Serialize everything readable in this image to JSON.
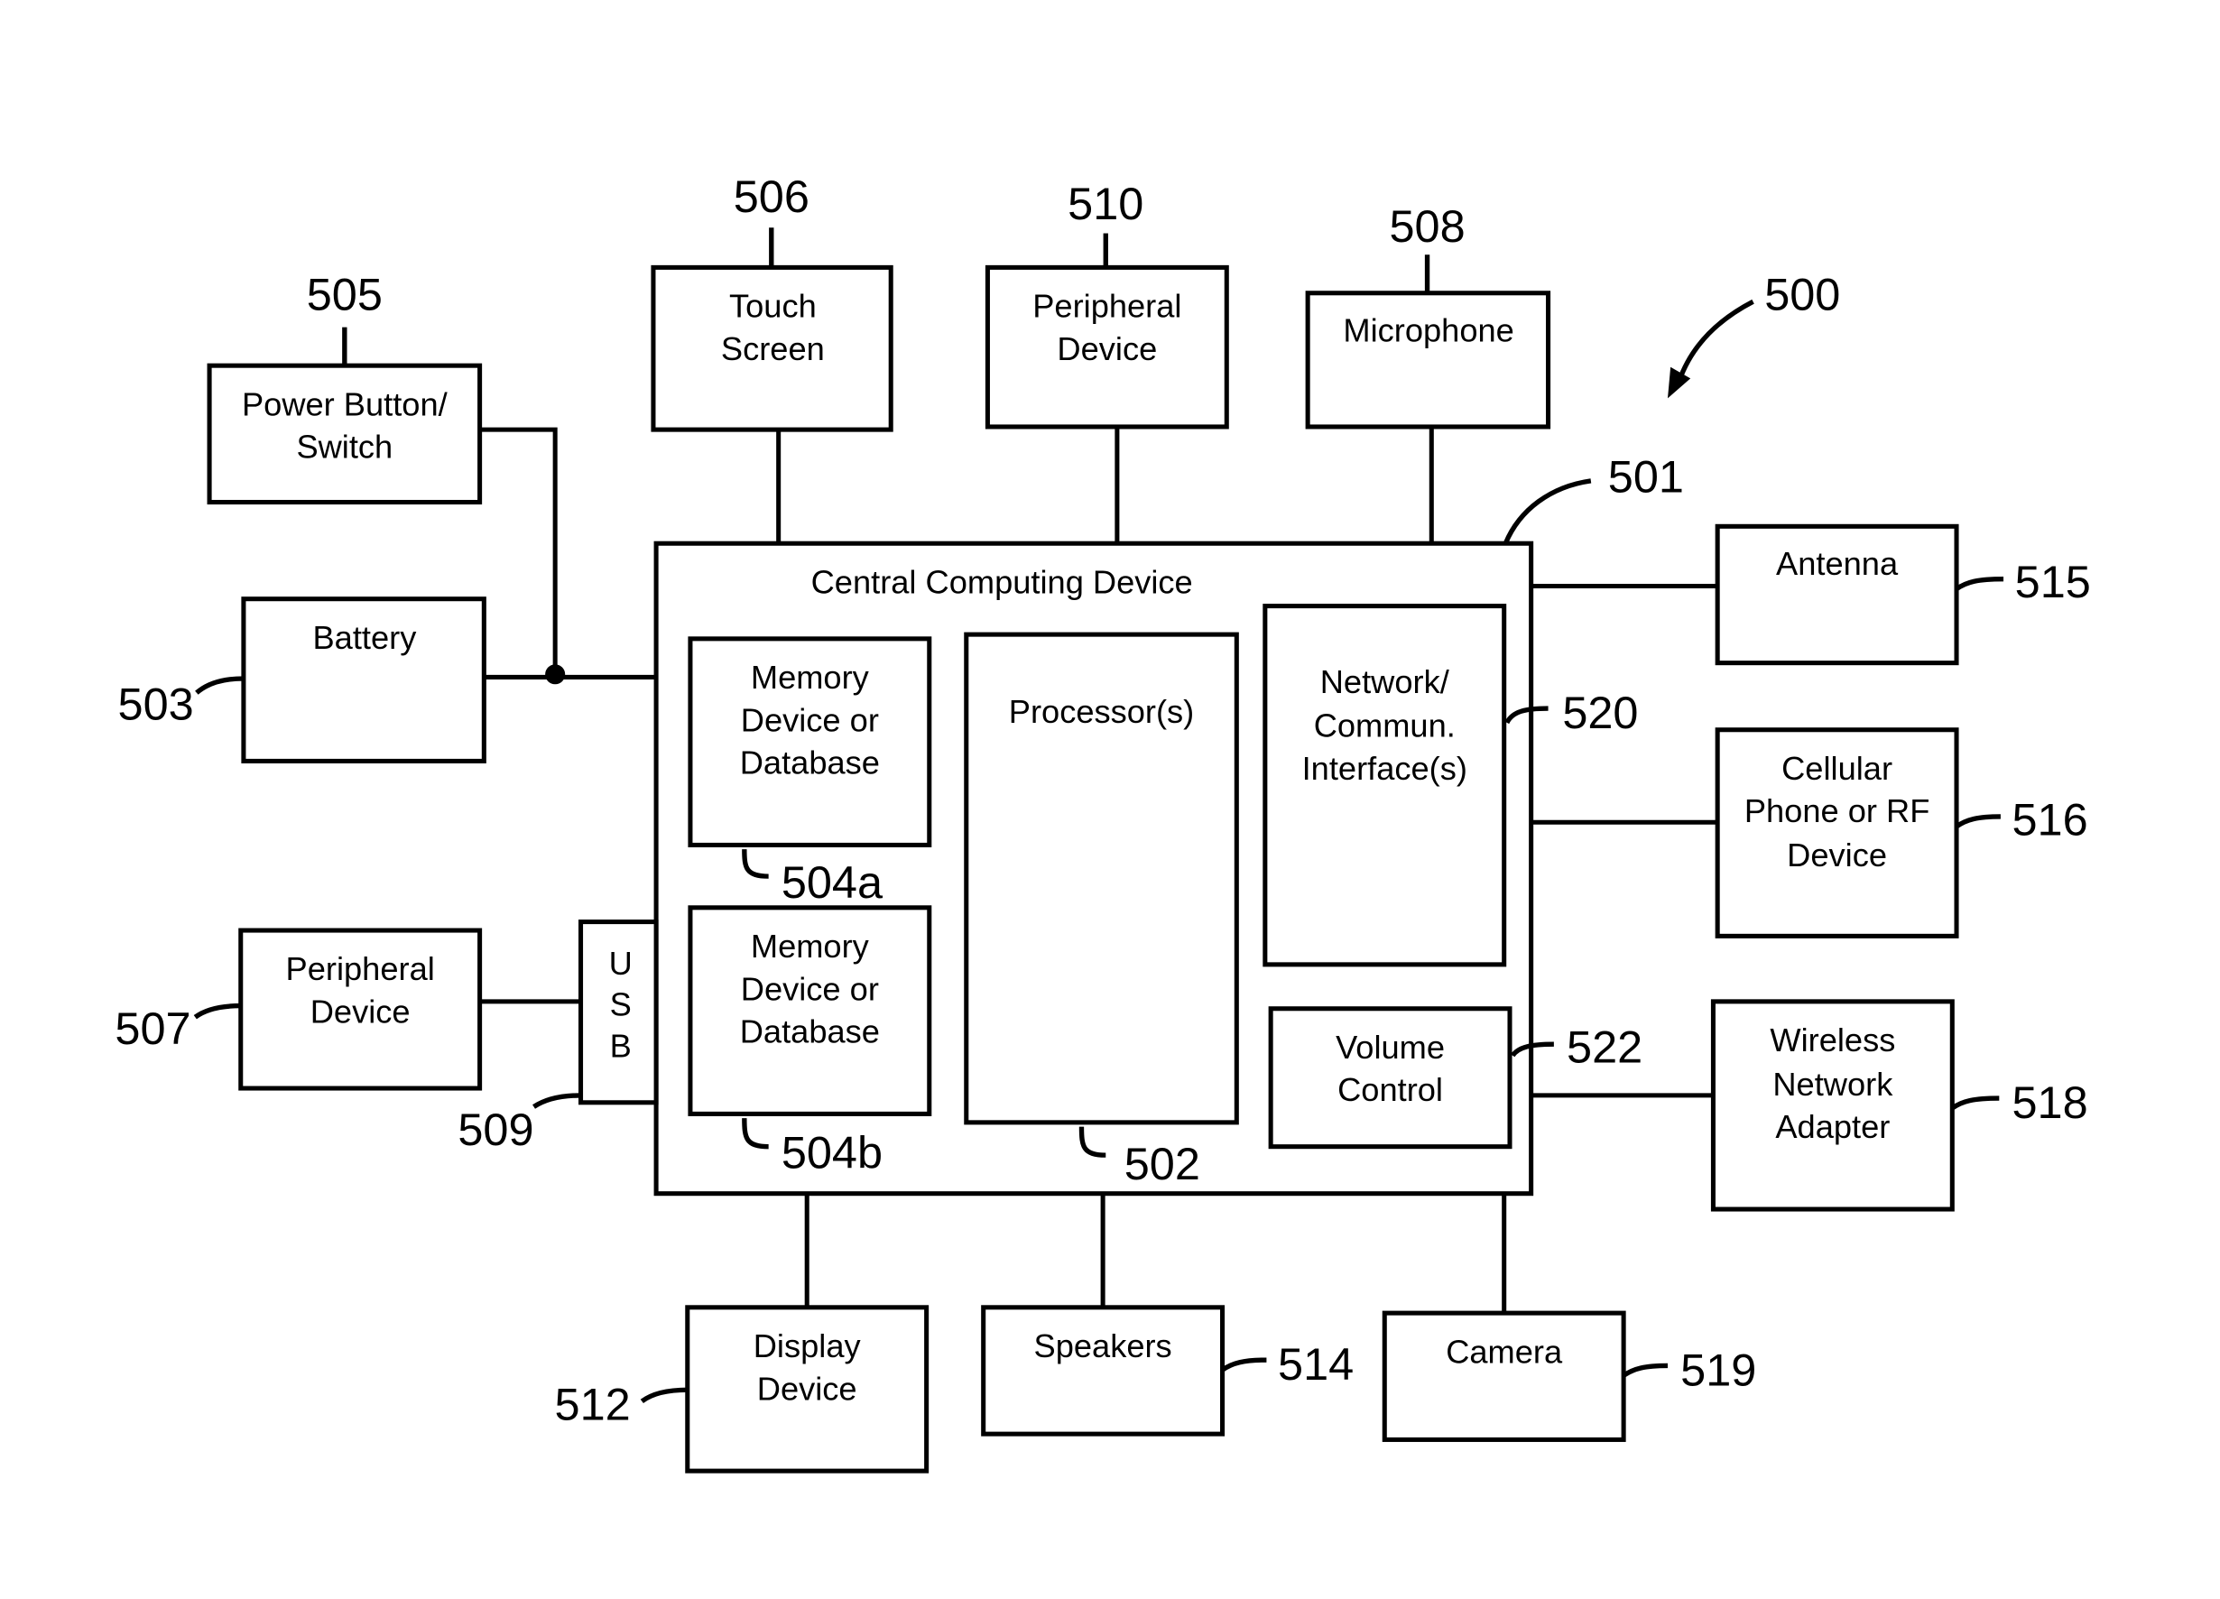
{
  "diagram": {
    "figure_ref": "500",
    "central": {
      "ref": "501",
      "title": "Central Computing Device",
      "components": {
        "memory_a": {
          "ref": "504a",
          "lines": [
            "Memory",
            "Device or",
            "Database"
          ]
        },
        "memory_b": {
          "ref": "504b",
          "lines": [
            "Memory",
            "Device or",
            "Database"
          ]
        },
        "processor": {
          "ref": "502",
          "lines": [
            "Processor(s)"
          ]
        },
        "network": {
          "ref": "520",
          "lines": [
            "Network/",
            "Commun.",
            "Interface(s)"
          ]
        },
        "volume": {
          "ref": "522",
          "lines": [
            "Volume",
            "Control"
          ]
        }
      }
    },
    "usb": {
      "ref": "509",
      "lines": [
        "U",
        "S",
        "B"
      ]
    },
    "peripherals": {
      "power": {
        "ref": "505",
        "lines": [
          "Power Button/",
          "Switch"
        ]
      },
      "battery": {
        "ref": "503",
        "lines": [
          "Battery"
        ]
      },
      "peripheral_left": {
        "ref": "507",
        "lines": [
          "Peripheral",
          "Device"
        ]
      },
      "touch": {
        "ref": "506",
        "lines": [
          "Touch",
          "Screen"
        ]
      },
      "peripheral_top": {
        "ref": "510",
        "lines": [
          "Peripheral",
          "Device"
        ]
      },
      "microphone": {
        "ref": "508",
        "lines": [
          "Microphone"
        ]
      },
      "antenna": {
        "ref": "515",
        "lines": [
          "Antenna"
        ]
      },
      "cellular": {
        "ref": "516",
        "lines": [
          "Cellular",
          "Phone or RF",
          "Device"
        ]
      },
      "wireless": {
        "ref": "518",
        "lines": [
          "Wireless",
          "Network",
          "Adapter"
        ]
      },
      "display": {
        "ref": "512",
        "lines": [
          "Display",
          "Device"
        ]
      },
      "speakers": {
        "ref": "514",
        "lines": [
          "Speakers"
        ]
      },
      "camera": {
        "ref": "519",
        "lines": [
          "Camera"
        ]
      }
    }
  }
}
